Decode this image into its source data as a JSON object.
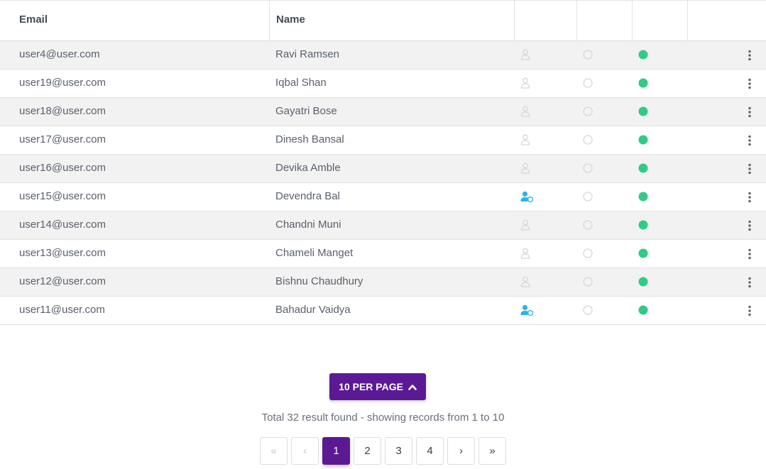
{
  "colors": {
    "accent": "#5b1a94",
    "status_active": "#2ecc84",
    "admin_icon": "#2bb5dc",
    "user_icon_muted": "#d3d6db"
  },
  "table": {
    "headers": {
      "email": "Email",
      "name": "Name"
    },
    "rows": [
      {
        "email": "user4@user.com",
        "name": "Ravi Ramsen",
        "role_icon": "user-icon"
      },
      {
        "email": "user19@user.com",
        "name": "Iqbal Shan",
        "role_icon": "user-icon"
      },
      {
        "email": "user18@user.com",
        "name": "Gayatri Bose",
        "role_icon": "user-icon"
      },
      {
        "email": "user17@user.com",
        "name": "Dinesh Bansal",
        "role_icon": "user-icon"
      },
      {
        "email": "user16@user.com",
        "name": "Devika Amble",
        "role_icon": "user-icon"
      },
      {
        "email": "user15@user.com",
        "name": "Devendra Bal",
        "role_icon": "user-shield-icon"
      },
      {
        "email": "user14@user.com",
        "name": "Chandni Muni",
        "role_icon": "user-icon"
      },
      {
        "email": "user13@user.com",
        "name": "Chameli Manget",
        "role_icon": "user-icon"
      },
      {
        "email": "user12@user.com",
        "name": "Bishnu Chaudhury",
        "role_icon": "user-icon"
      },
      {
        "email": "user11@user.com",
        "name": "Bahadur Vaidya",
        "role_icon": "user-shield-icon"
      }
    ]
  },
  "pagination": {
    "per_page_label": "10 PER PAGE",
    "summary": "Total 32 result found - showing records from 1 to 10",
    "first": "«",
    "prev": "‹",
    "pages": [
      "1",
      "2",
      "3",
      "4"
    ],
    "current_page": "1",
    "next": "›",
    "last": "»"
  }
}
